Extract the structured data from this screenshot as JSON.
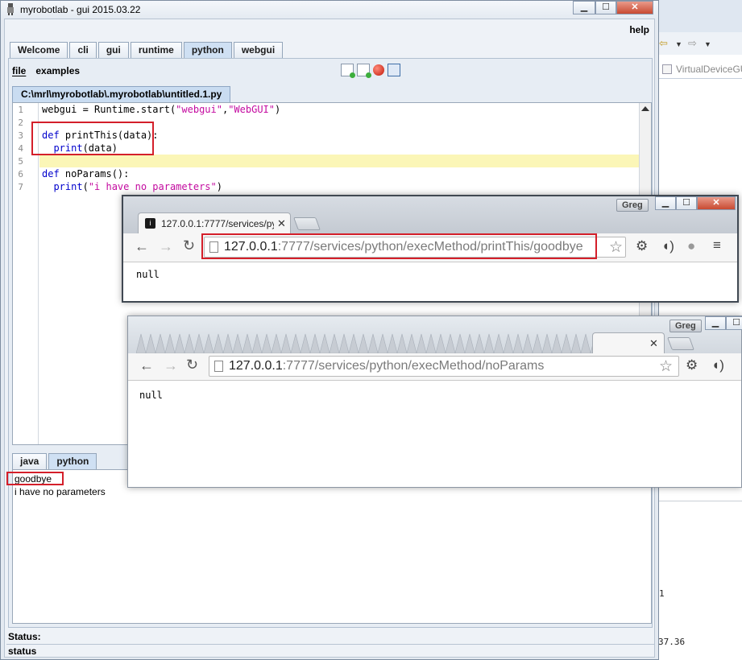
{
  "background_app": {
    "tab_label": "VirtualDeviceGUI.",
    "fragment_1": "1",
    "fragment_2": "37.36"
  },
  "mrl": {
    "title": "myrobotlab - gui 2015.03.22",
    "menu_help": "help",
    "tabs": [
      "Welcome",
      "cli",
      "gui",
      "runtime",
      "python",
      "webgui"
    ],
    "active_tab": "python",
    "file_menu": "file",
    "examples_menu": "examples",
    "file_tab": "C:\\mrl\\myrobotlab\\.myrobotlab\\untitled.1.py",
    "code_lines": [
      "webgui = Runtime.start(\"webgui\",\"WebGUI\")",
      "",
      "def printThis(data):",
      "  print(data)",
      "",
      "def noParams():",
      "  print(\"i have no parameters\")"
    ],
    "line_numbers": [
      "1",
      "2",
      "3",
      "4",
      "5",
      "6",
      "7"
    ],
    "bottom_tabs": [
      "java",
      "python"
    ],
    "console_lines": [
      "goodbye",
      "i have no parameters"
    ],
    "status_label": "Status:",
    "status_text": "status"
  },
  "browser1": {
    "user": "Greg",
    "tab_title": "127.0.0.1:7777/services/py",
    "url_host": "127.0.0.1",
    "url_rest": ":7777/services/python/execMethod/printThis/goodbye",
    "content": "null"
  },
  "browser2": {
    "user": "Greg",
    "url_host": "127.0.0.1",
    "url_rest": ":7777/services/python/execMethod/noParams",
    "content": "null"
  },
  "colors": {
    "annotation_red": "#d41f2a",
    "keyword_blue": "#0000cc",
    "string_magenta": "#c40ba0",
    "current_line": "#fbf6b7"
  }
}
